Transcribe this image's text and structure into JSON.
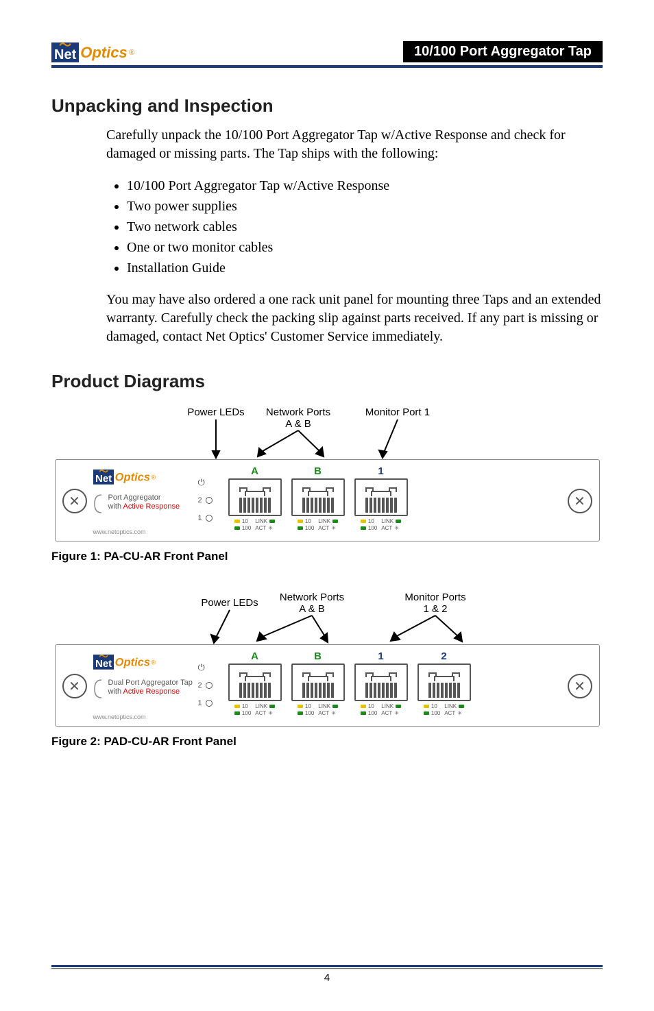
{
  "header": {
    "logo_net": "Net",
    "logo_optics": "Optics",
    "logo_reg": "®",
    "title": "10/100 Port Aggregator Tap"
  },
  "section1": {
    "heading": "Unpacking and Inspection",
    "intro": "Carefully unpack the 10/100 Port Aggregator Tap w/Active Response and check for damaged or missing parts. The Tap ships with the following:",
    "items": [
      "10/100 Port Aggregator Tap w/Active Response",
      "Two power supplies",
      "Two network cables",
      "One or two monitor cables",
      "Installation Guide"
    ],
    "outro": "You may have also ordered a one rack unit panel for mounting three Taps and an extended warranty. Carefully check the packing slip against parts received. If any part is missing or damaged, contact Net Optics' Customer Service immediately."
  },
  "section2": {
    "heading": "Product Diagrams"
  },
  "fig1": {
    "callout_power": "Power LEDs",
    "callout_network_l1": "Network Ports",
    "callout_network_l2": "A & B",
    "callout_monitor": "Monitor Port 1",
    "panel_sub_l1": "Port Aggregator",
    "panel_sub_l2a": "with ",
    "panel_sub_l2b": "Active Response",
    "url": "www.netoptics.com",
    "ports": [
      "A",
      "B",
      "1"
    ],
    "caption_b": "Figure 1: ",
    "caption": "PA-CU-AR Front Panel"
  },
  "fig2": {
    "callout_power": "Power LEDs",
    "callout_network_l1": "Network Ports",
    "callout_network_l2": "A & B",
    "callout_monitor_l1": "Monitor Ports",
    "callout_monitor_l2": "1 & 2",
    "panel_sub_l1": "Dual Port Aggregator Tap",
    "panel_sub_l2a": "with ",
    "panel_sub_l2b": "Active Response",
    "url": "www.netoptics.com",
    "ports": [
      "A",
      "B",
      "1",
      "2"
    ],
    "caption_b": "Figure 2: ",
    "caption": "PAD-CU-AR Front Panel"
  },
  "port_legend": {
    "l10": "10",
    "l100": "100",
    "link": "LINK",
    "act": "ACT"
  },
  "power": {
    "n2": "2",
    "n1": "1"
  },
  "page_number": "4"
}
